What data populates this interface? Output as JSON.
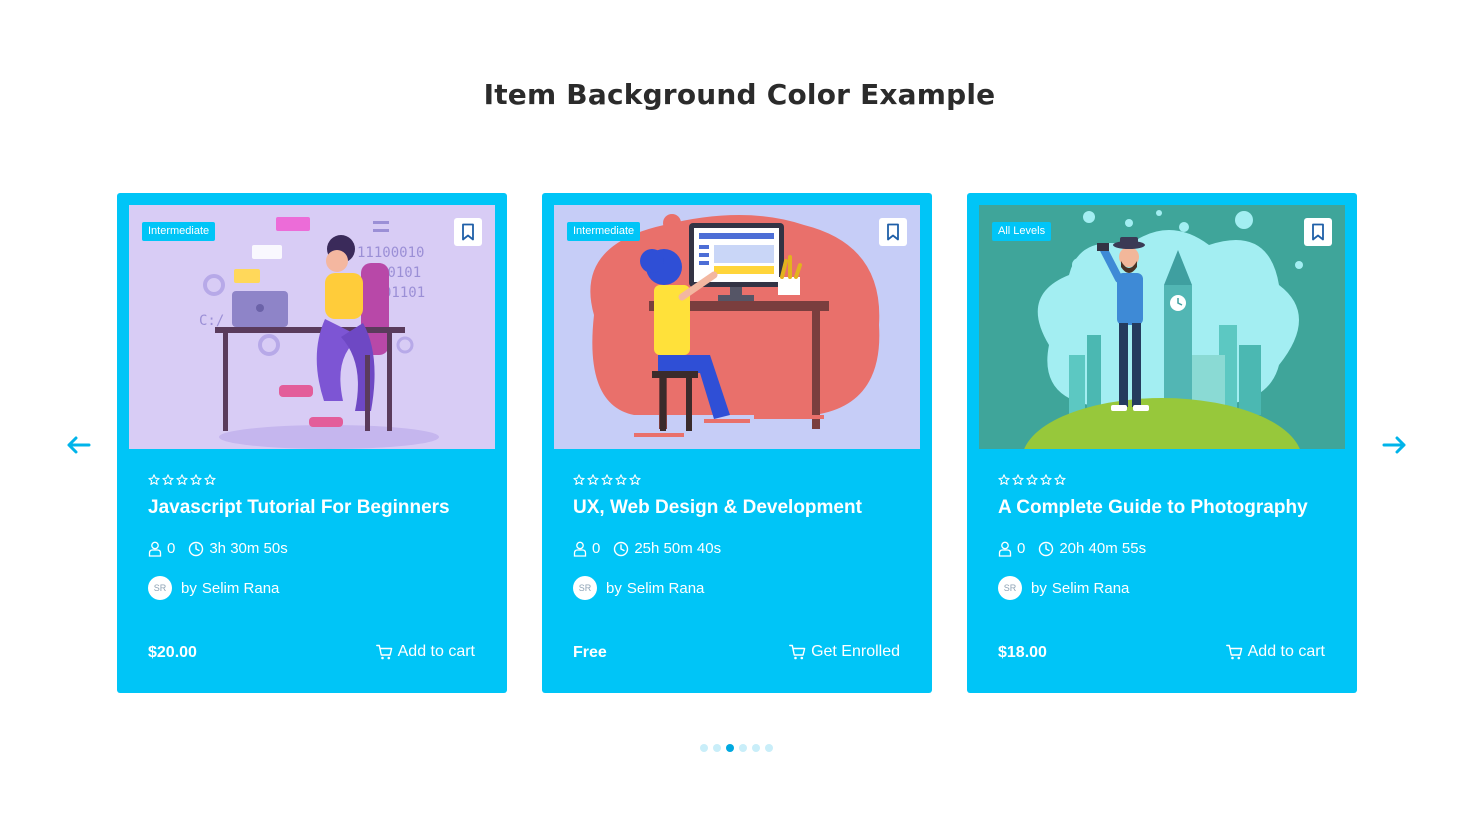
{
  "section": {
    "title": "Item Background Color Example"
  },
  "colors": {
    "card_background": "#00c5f7",
    "arrow": "#00b4ea",
    "dot_active": "#00a9e0",
    "dot_inactive": "#c9eef9"
  },
  "navigation": {
    "prev_icon": "arrow-left-icon",
    "next_icon": "arrow-right-icon"
  },
  "courses": [
    {
      "level": "Intermediate",
      "rating": 0,
      "title": "Javascript Tutorial For Beginners",
      "students": "0",
      "duration": "3h 30m 50s",
      "author_initials": "SR",
      "by": "by",
      "author": "Selim Rana",
      "price": "$20.00",
      "cta": "Add to cart"
    },
    {
      "level": "Intermediate",
      "rating": 0,
      "title": "UX, Web Design & Development",
      "students": "0",
      "duration": "25h 50m 40s",
      "author_initials": "SR",
      "by": "by",
      "author": "Selim Rana",
      "price": "Free",
      "cta": "Get Enrolled"
    },
    {
      "level": "All Levels",
      "rating": 0,
      "title": "A Complete Guide to Photography",
      "students": "0",
      "duration": "20h 40m 55s",
      "author_initials": "SR",
      "by": "by",
      "author": "Selim Rana",
      "price": "$18.00",
      "cta": "Add to cart"
    }
  ],
  "pagination": {
    "count": 6,
    "active_index": 2
  }
}
